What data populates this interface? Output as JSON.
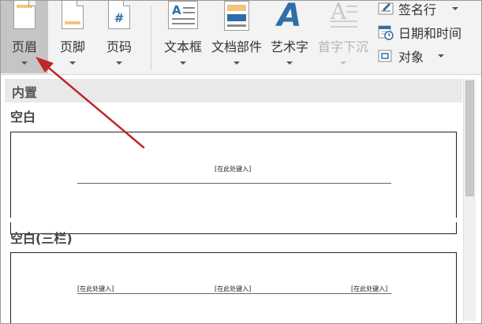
{
  "ribbon": {
    "header_button": {
      "label": "页眉",
      "icon": "header-page-icon"
    },
    "footer_button": {
      "label": "页脚",
      "icon": "footer-page-icon"
    },
    "page_number_button": {
      "label": "页码",
      "icon": "page-number-icon",
      "glyph": "#"
    },
    "textbox_button": {
      "label": "文本框",
      "icon": "textbox-icon",
      "glyph": "A"
    },
    "quick_parts_button": {
      "label": "文档部件",
      "icon": "quick-parts-icon"
    },
    "wordart_button": {
      "label": "艺术字",
      "icon": "wordart-icon",
      "glyph": "A"
    },
    "dropcap_button": {
      "label": "首字下沉",
      "icon": "dropcap-icon",
      "glyph": "A",
      "disabled": true
    },
    "signature_line": {
      "label": "签名行",
      "icon": "signature-line-icon"
    },
    "date_time": {
      "label": "日期和时间",
      "icon": "calendar-clock-icon"
    },
    "object": {
      "label": "对象",
      "icon": "object-icon"
    }
  },
  "gallery": {
    "category": "内置",
    "items": [
      {
        "title": "空白",
        "placeholders": [
          "[在此处键入]"
        ]
      },
      {
        "title": "空白(三栏)",
        "placeholders": [
          "[在此处键入]",
          "[在此处键入]",
          "[在此处键入]"
        ]
      }
    ]
  },
  "colors": {
    "accent_blue": "#2e6ea8",
    "band_orange": "#f2c57c",
    "arrow_red": "#c0262d",
    "active_bg": "#c5c5c5"
  }
}
